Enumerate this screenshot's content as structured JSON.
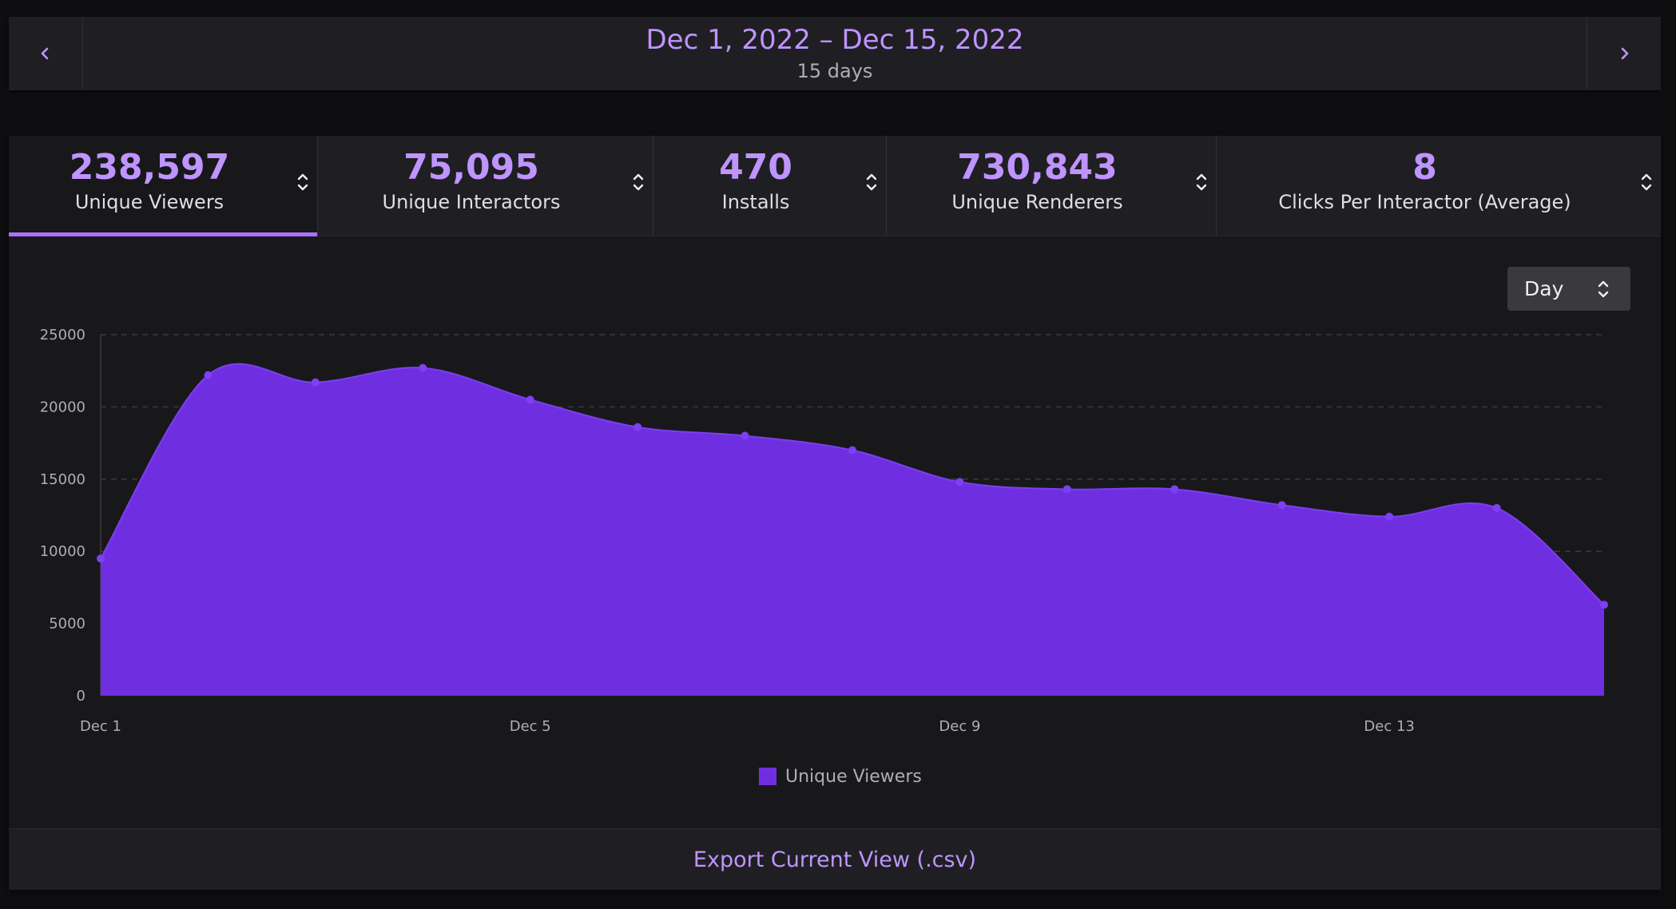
{
  "date_nav": {
    "range": "Dec 1, 2022 – Dec 15, 2022",
    "duration": "15 days",
    "prev_icon": "chevron-left-icon",
    "next_icon": "chevron-right-icon"
  },
  "tabs": [
    {
      "value": "238,597",
      "label": "Unique Viewers",
      "active": true
    },
    {
      "value": "75,095",
      "label": "Unique Interactors",
      "active": false
    },
    {
      "value": "470",
      "label": "Installs",
      "active": false
    },
    {
      "value": "730,843",
      "label": "Unique Renderers",
      "active": false
    },
    {
      "value": "8",
      "label": "Clicks Per Interactor (Average)",
      "active": false
    }
  ],
  "granularity_select": {
    "value": "Day",
    "icon": "sort-arrows-icon"
  },
  "export_label": "Export Current View (.csv)",
  "colors": {
    "accent": "#bf94ff",
    "series": "#6f2fe0",
    "active_underline": "#a970ff",
    "background": "#18181b"
  },
  "chart_data": {
    "type": "area",
    "x": [
      "Dec 1",
      "Dec 2",
      "Dec 3",
      "Dec 4",
      "Dec 5",
      "Dec 6",
      "Dec 7",
      "Dec 8",
      "Dec 9",
      "Dec 10",
      "Dec 11",
      "Dec 12",
      "Dec 13",
      "Dec 14",
      "Dec 15"
    ],
    "x_tick_labels": [
      "Dec 1",
      "Dec 5",
      "Dec 9",
      "Dec 13"
    ],
    "series": [
      {
        "name": "Unique Viewers",
        "values": [
          9500,
          22200,
          21700,
          22700,
          20500,
          18600,
          18000,
          17000,
          14800,
          14300,
          14300,
          13200,
          12400,
          13000,
          6300
        ]
      }
    ],
    "y_ticks": [
      0,
      5000,
      10000,
      15000,
      20000,
      25000
    ],
    "ylim": [
      0,
      25000
    ],
    "grid": "horizontal dashed",
    "legend_position": "bottom"
  }
}
